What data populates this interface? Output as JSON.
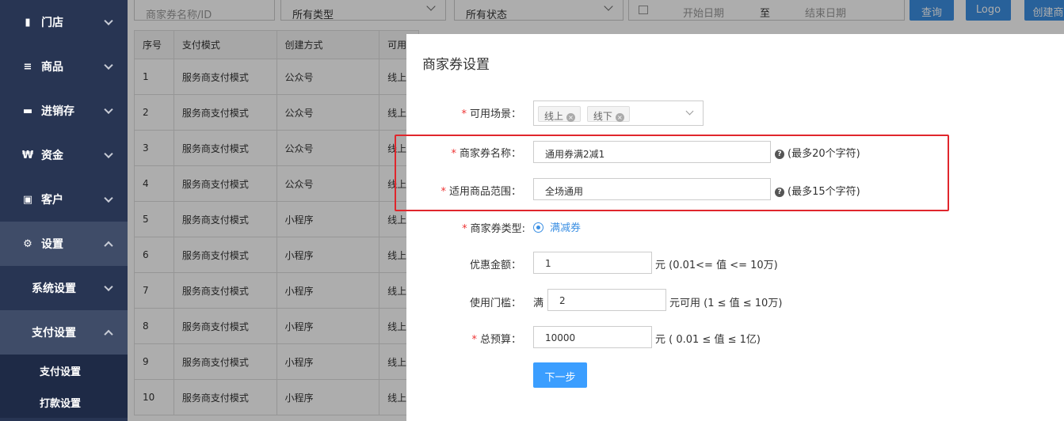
{
  "sidebar": {
    "items": [
      {
        "label": "门店",
        "icon": "store-icon"
      },
      {
        "label": "商品",
        "icon": "list-icon"
      },
      {
        "label": "进销存",
        "icon": "truck-icon"
      },
      {
        "label": "资金",
        "icon": "won-icon"
      },
      {
        "label": "客户",
        "icon": "id-card-icon"
      },
      {
        "label": "设置",
        "icon": "gear-icon"
      }
    ],
    "sub_items": [
      {
        "label": "系统设置"
      },
      {
        "label": "支付设置"
      }
    ],
    "leaf_items": [
      {
        "label": "支付设置"
      },
      {
        "label": "打款设置"
      }
    ]
  },
  "filters": {
    "name_placeholder": "商家券名称/ID",
    "type_value": "所有类型",
    "status_value": "所有状态",
    "start_date_placeholder": "开始日期",
    "date_sep": "至",
    "end_date_placeholder": "结束日期",
    "query_label": "查询",
    "logo_label": "Logo",
    "create_label": "创建商"
  },
  "table": {
    "headers": [
      "序号",
      "支付模式",
      "创建方式",
      "可用"
    ],
    "rows": [
      [
        "1",
        "服务商支付模式",
        "公众号",
        "线上"
      ],
      [
        "2",
        "服务商支付模式",
        "公众号",
        "线上"
      ],
      [
        "3",
        "服务商支付模式",
        "公众号",
        "线上"
      ],
      [
        "4",
        "服务商支付模式",
        "公众号",
        "线上"
      ],
      [
        "5",
        "服务商支付模式",
        "小程序",
        "线上"
      ],
      [
        "6",
        "服务商支付模式",
        "小程序",
        "线上"
      ],
      [
        "7",
        "服务商支付模式",
        "小程序",
        "线上"
      ],
      [
        "8",
        "服务商支付模式",
        "小程序",
        "线上"
      ],
      [
        "9",
        "服务商支付模式",
        "小程序",
        "线上"
      ],
      [
        "10",
        "服务商支付模式",
        "小程序",
        "线上"
      ]
    ]
  },
  "modal": {
    "title": "商家券设置",
    "required_mark": "*",
    "scene_label": "可用场景：",
    "scene_tags": [
      "线上",
      "线下"
    ],
    "name_label": "商家券名称：",
    "name_value": "通用券满2减1",
    "name_hint": "(最多20个字符)",
    "range_label": "适用商品范围：",
    "range_value": "全场通用",
    "range_hint": "(最多15个字符)",
    "type_label": "商家券类型:",
    "type_option": "满减券",
    "amount_label": "优惠金额：",
    "amount_value": "1",
    "amount_hint": "元 (0.01<= 值 <= 10万)",
    "threshold_label": "使用门槛：",
    "threshold_prefix": "满",
    "threshold_value": "2",
    "threshold_hint": "元可用 (1 ≤ 值 ≤ 10万)",
    "budget_label": "总预算：",
    "budget_value": "10000",
    "budget_hint": "元 ( 0.01 ≤ 值 ≤ 1亿)",
    "next_label": "下一步",
    "question_glyph": "?",
    "tag_close_glyph": "×"
  },
  "colors": {
    "sidebar_bg": "#283553",
    "accent": "#3b8fe3",
    "highlight_border": "#e0262c",
    "required": "#e33"
  }
}
